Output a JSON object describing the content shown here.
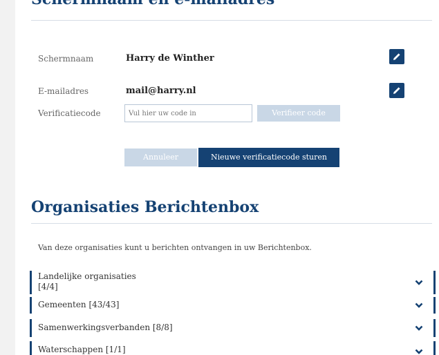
{
  "top_heading": "Schermnaam en e-mailadres",
  "profile": {
    "screenname_label": "Schermnaam",
    "screenname_value": "Harry de Winther",
    "email_label": "E-mailadres",
    "email_value": "mail@harry.nl",
    "verif_label": "Verificatiecode",
    "verif_placeholder": "Vul hier uw code in",
    "verify_button": "Verifieer code",
    "cancel_button": "Annuleer",
    "new_code_button": "Nieuwe verificatiecode sturen"
  },
  "organisations": {
    "heading": "Organisaties Berichtenbox",
    "intro": "Van deze organisaties kunt u berichten ontvangen in uw Berichtenbox.",
    "groups": [
      {
        "label": "Landelijke organisaties",
        "count": "[4/4]"
      },
      {
        "label": "Gemeenten [43/43]"
      },
      {
        "label": "Samenwerkingsverbanden [8/8]"
      },
      {
        "label": "Waterschappen [1/1]"
      }
    ]
  },
  "colors": {
    "brand": "#154273",
    "disabled": "#c9d7e6"
  },
  "icons": {
    "edit": "pencil-icon",
    "expand": "chevron-down-icon"
  }
}
